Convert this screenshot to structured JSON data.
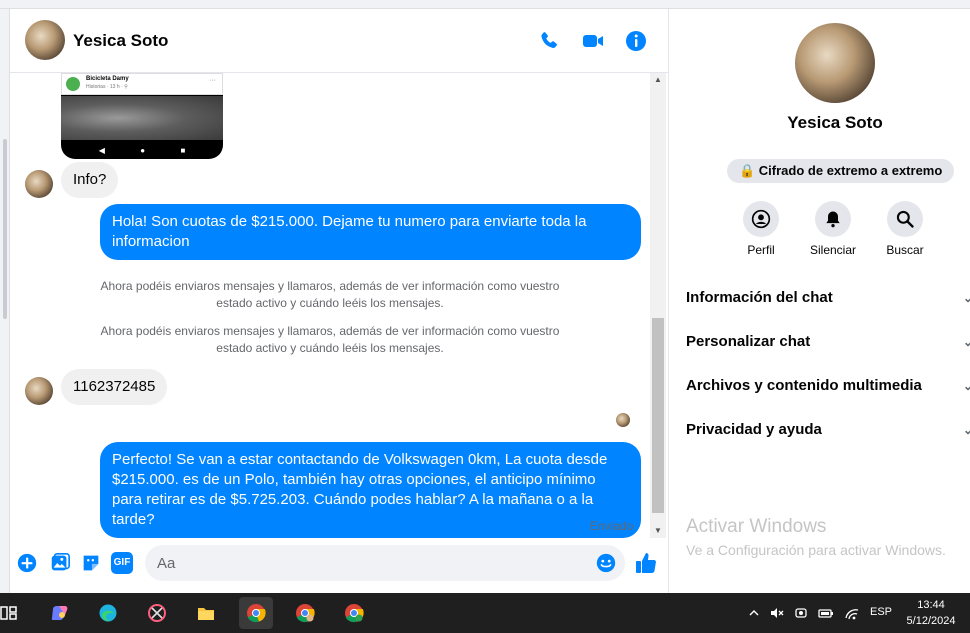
{
  "header": {
    "contact_name": "Yesica Soto",
    "icons": [
      "phone-icon",
      "video-call-icon",
      "info-icon"
    ],
    "accent": "#0084ff"
  },
  "preview": {
    "page_name": "Bicicleta Damy",
    "meta": "Historias · 13 h · ⚲",
    "dots": "···",
    "nav_back": "◀",
    "nav_home": "●",
    "nav_recent": "■"
  },
  "messages": {
    "in1": "Info?",
    "out1": "Hola! Son cuotas de $215.000. Dejame tu numero para enviarte toda la informacion",
    "sys1": "Ahora podéis enviaros mensajes y llamaros, además de ver información como vuestro estado activo y cuándo leéis los mensajes.",
    "sys2": "Ahora podéis enviaros mensajes y llamaros, además de ver información como vuestro estado activo y cuándo leéis los mensajes.",
    "in2": "1162372485",
    "out2": "Perfecto!  Se van a estar contactando de Volkswagen 0km, La cuota desde $215.000. es de un Polo, también hay otras opciones, el anticipo mínimo para retirar es de $5.725.203. Cuándo podes hablar? A la mañana o a la tarde?",
    "status": "Enviado"
  },
  "composer": {
    "placeholder": "Aa",
    "gif_label": "GIF",
    "icons": [
      "plus-icon",
      "gallery-icon",
      "sticker-icon",
      "gif-icon",
      "emoji-icon",
      "like-icon"
    ]
  },
  "sidebar": {
    "name": "Yesica Soto",
    "encryption": "🔒 Cifrado de extremo a extremo",
    "actions": [
      {
        "label": "Perfil"
      },
      {
        "label": "Silenciar"
      },
      {
        "label": "Buscar"
      }
    ],
    "menu": [
      {
        "label": "Información del chat"
      },
      {
        "label": "Personalizar chat"
      },
      {
        "label": "Archivos y contenido multimedia"
      },
      {
        "label": "Privacidad y ayuda"
      }
    ],
    "watermark_title": "Activar Windows",
    "watermark_sub": "Ve a Configuración para activar Windows."
  },
  "taskbar": {
    "lang": "ESP",
    "time": "13:44",
    "date": "5/12/2024",
    "icons": [
      "task-view-icon",
      "copilot-icon",
      "edge-icon",
      "snipping-tool-icon",
      "file-explorer-icon",
      "chrome-icon",
      "chrome-profile-icon",
      "chrome-profile-2-icon"
    ]
  }
}
